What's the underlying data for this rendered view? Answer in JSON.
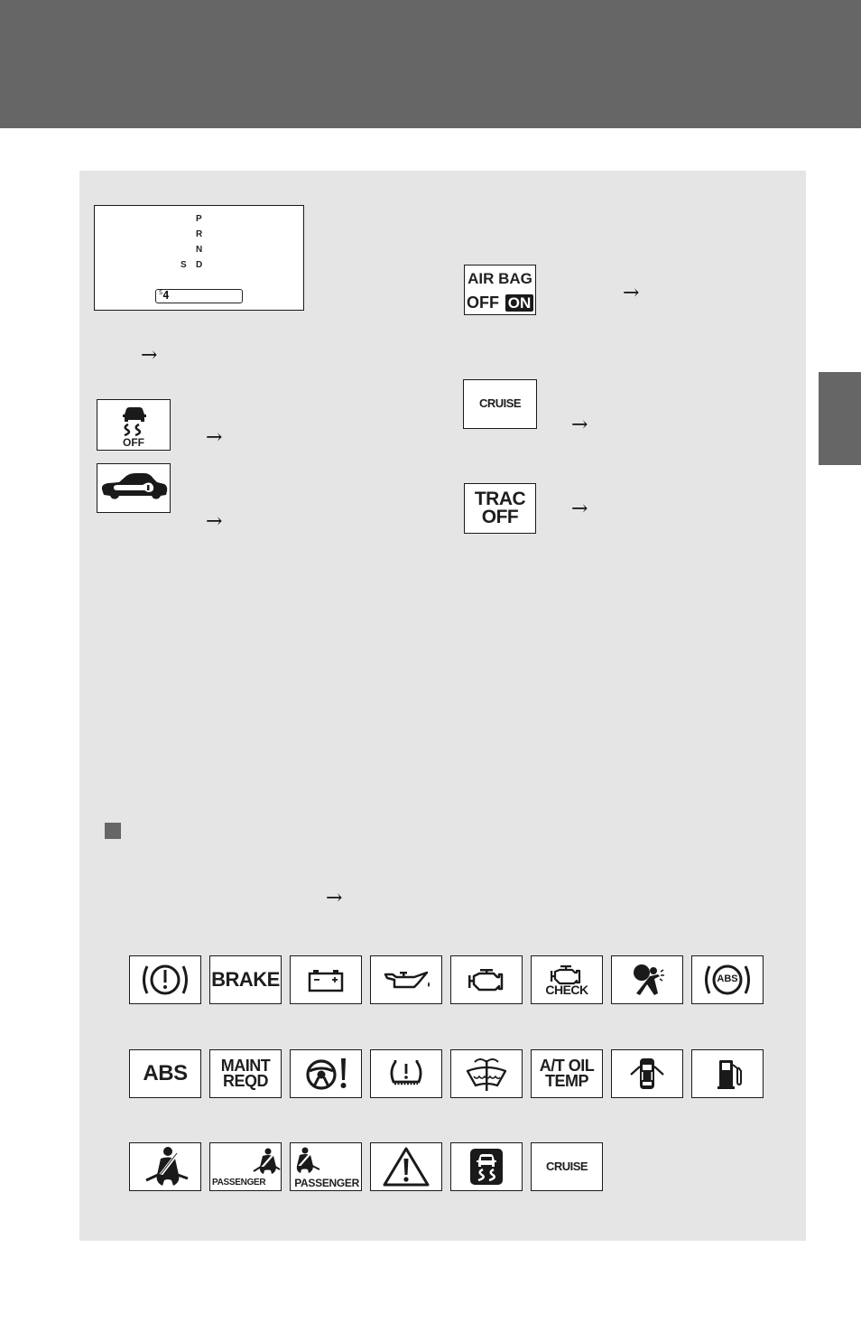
{
  "page": {
    "header_color": "#666666",
    "panel_color": "#e5e5e5",
    "tab_color": "#666666"
  },
  "shift_display": {
    "gears": [
      "P",
      "R",
      "N",
      "D"
    ],
    "sport_label": "S",
    "readout_prefix": "S",
    "readout_value": "4"
  },
  "arrows": {
    "symbol": "→"
  },
  "indicators_left": [
    {
      "name": "vsc-off",
      "text": "OFF"
    },
    {
      "name": "security-key",
      "text": ""
    }
  ],
  "indicators_right": [
    {
      "name": "airbag-off-on",
      "line1": "AIR BAG",
      "line2_off": "OFF",
      "line2_on": "ON"
    },
    {
      "name": "cruise",
      "text": "CRUISE"
    },
    {
      "name": "trac-off",
      "line1": "TRAC",
      "line2": "OFF"
    }
  ],
  "warning_lights": {
    "row1": [
      {
        "name": "brake-circle",
        "text": ""
      },
      {
        "name": "brake-text",
        "text": "BRAKE"
      },
      {
        "name": "battery",
        "text": ""
      },
      {
        "name": "oil-pressure",
        "text": ""
      },
      {
        "name": "check-engine",
        "text": ""
      },
      {
        "name": "check-engine-text",
        "text": "CHECK"
      },
      {
        "name": "srs-airbag",
        "text": ""
      },
      {
        "name": "abs-circle",
        "text": "ABS"
      }
    ],
    "row2": [
      {
        "name": "abs-text",
        "text": "ABS"
      },
      {
        "name": "maint-reqd",
        "line1": "MAINT",
        "line2": "REQD"
      },
      {
        "name": "power-steering",
        "text": ""
      },
      {
        "name": "tire-pressure",
        "text": ""
      },
      {
        "name": "washer-fluid",
        "text": ""
      },
      {
        "name": "at-oil-temp",
        "line1": "A/T OIL",
        "line2": "TEMP"
      },
      {
        "name": "door-open",
        "text": ""
      },
      {
        "name": "low-fuel",
        "text": ""
      }
    ],
    "row3": [
      {
        "name": "seatbelt-driver",
        "text": ""
      },
      {
        "name": "seatbelt-passenger-small",
        "text": "PASSENGER"
      },
      {
        "name": "seatbelt-passenger",
        "text": "PASSENGER"
      },
      {
        "name": "master-warning",
        "text": ""
      },
      {
        "name": "slip-indicator",
        "text": ""
      },
      {
        "name": "cruise-text",
        "text": "CRUISE"
      }
    ]
  }
}
